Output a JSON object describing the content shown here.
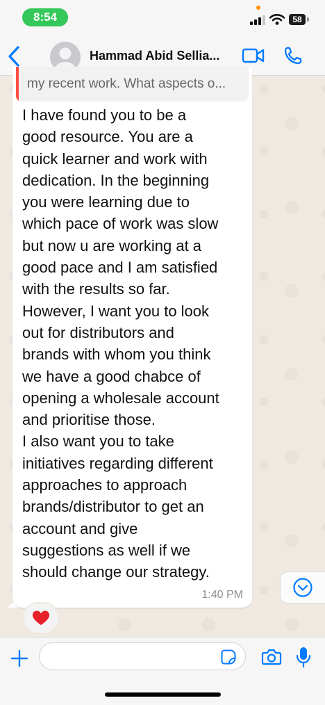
{
  "status_bar": {
    "time": "8:54",
    "battery": "58",
    "icons": [
      "signal-icon",
      "wifi-icon",
      "battery-icon"
    ]
  },
  "header": {
    "contact_name": "Hammad Abid Sellia...",
    "icons": [
      "back-chevron-icon",
      "avatar-icon",
      "video-call-icon",
      "phone-call-icon"
    ]
  },
  "message": {
    "quoted_text": "my recent work. What aspects o...",
    "body": "I have found you to be a\ngood resource. You are a\nquick learner and work with\ndedication. In the beginning\nyou were learning due to\nwhich pace of work was slow\nbut now u are working at a\ngood pace and I am satisfied\nwith the results so far.\nHowever, I want you to look\nout for distributors and\nbrands with whom you think\nwe have a good chabce of\nopening a wholesale account\nand prioritise those.\nI also want you to take\ninitiatives regarding different\napproaches to approach\nbrands/distributor to get an\naccount and give\nsuggestions as well if we\nshould change our strategy.",
    "time": "1:40 PM",
    "reaction": "❤️"
  },
  "input_bar": {
    "placeholder": "",
    "icons": [
      "plus-icon",
      "sticker-icon",
      "camera-icon",
      "microphone-icon"
    ]
  },
  "colors": {
    "accent": "#007aff",
    "time_pill": "#34c759",
    "reply_bar": "#ff4f44",
    "wallpaper": "#efe9e1"
  }
}
